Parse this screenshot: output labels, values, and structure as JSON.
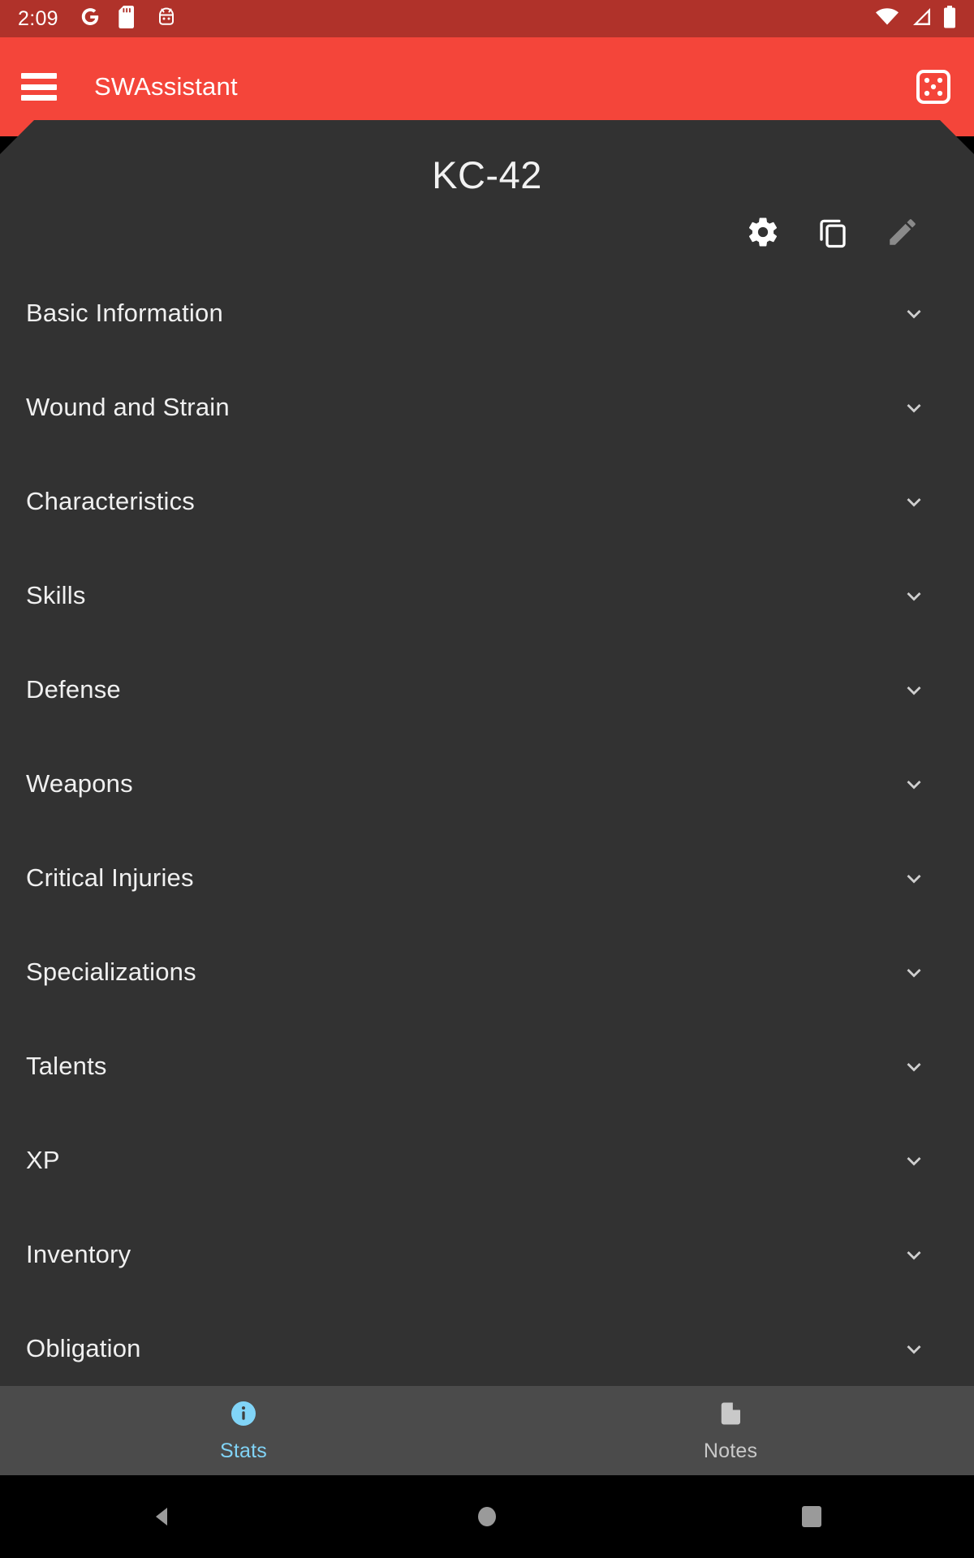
{
  "status_bar": {
    "clock": "2:09",
    "left_icons": [
      "google-icon",
      "sd-card-icon",
      "android-head-icon"
    ],
    "right_icons": [
      "wifi-icon",
      "cell-signal-icon",
      "battery-icon"
    ],
    "background_color": "#b0322a"
  },
  "app_bar": {
    "menu_icon": "hamburger-menu-icon",
    "title": "SWAssistant",
    "action_icon": "dice-icon",
    "background_color": "#f4453a"
  },
  "character": {
    "name": "KC-42",
    "actions": [
      {
        "name": "settings",
        "icon": "gear-icon",
        "enabled": true
      },
      {
        "name": "duplicate",
        "icon": "copy-icon",
        "enabled": true
      },
      {
        "name": "edit",
        "icon": "pencil-icon",
        "enabled": false
      }
    ]
  },
  "sections": [
    {
      "label": "Basic Information",
      "expander": "chevron-down-icon"
    },
    {
      "label": "Wound and Strain",
      "expander": "chevron-down-icon"
    },
    {
      "label": "Characteristics",
      "expander": "chevron-down-icon"
    },
    {
      "label": "Skills",
      "expander": "chevron-down-icon"
    },
    {
      "label": "Defense",
      "expander": "chevron-down-icon"
    },
    {
      "label": "Weapons",
      "expander": "chevron-down-icon"
    },
    {
      "label": "Critical Injuries",
      "expander": "chevron-down-icon"
    },
    {
      "label": "Specializations",
      "expander": "chevron-down-icon"
    },
    {
      "label": "Talents",
      "expander": "chevron-down-icon"
    },
    {
      "label": "XP",
      "expander": "chevron-down-icon"
    },
    {
      "label": "Inventory",
      "expander": "chevron-down-icon"
    },
    {
      "label": "Obligation",
      "expander": "chevron-down-icon"
    }
  ],
  "tab_bar": {
    "background_color": "#4b4b4b",
    "active_color": "#81d4f7",
    "inactive_color": "#c9c9c9",
    "tabs": [
      {
        "label": "Stats",
        "icon": "info-circle-icon",
        "active": true
      },
      {
        "label": "Notes",
        "icon": "note-page-icon",
        "active": false
      }
    ]
  },
  "nav_bar": {
    "buttons": [
      {
        "name": "back",
        "icon": "back-triangle-icon"
      },
      {
        "name": "home",
        "icon": "home-circle-icon"
      },
      {
        "name": "recents",
        "icon": "recents-square-icon"
      }
    ]
  },
  "theme": {
    "content_background": "#323232",
    "text_primary": "#f0f0f0"
  }
}
